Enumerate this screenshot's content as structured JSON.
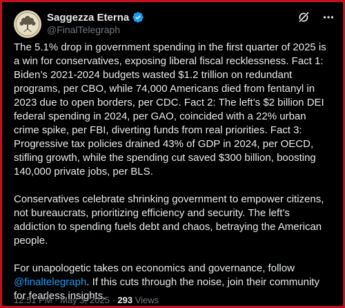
{
  "author": {
    "display_name": "Saggezza Eterna",
    "handle": "@FinalTelegraph",
    "verified": true,
    "avatar_icon": "tree-logo-icon"
  },
  "header_icons": [
    "grok-icon",
    "more-options-icon"
  ],
  "post": {
    "paragraph_1": "The 5.1% drop in government spending in the first quarter of 2025 is a win for conservatives, exposing liberal fiscal recklessness. Fact 1: Biden’s 2021-2024 budgets wasted $1.2 trillion on redundant programs, per CBO, while 74,000 Americans died from fentanyl in 2023 due to open borders, per CDC. Fact 2: The left’s $2 billion DEI federal spending in 2024, per GAO, coincided with a 22% urban crime spike, per FBI, diverting funds from real priorities. Fact 3: Progressive tax policies drained 43% of GDP in 2024, per OECD, stifling growth, while the spending cut saved $300 billion, boosting 140,000 private jobs, per BLS.",
    "paragraph_2": "Conservatives celebrate shrinking government to empower citizens, not bureaucrats, prioritizing efficiency and security. The left’s addiction to spending fuels debt and chaos, betraying the American people.",
    "paragraph_3_before": "For unapologetic takes on economics and governance, follow ",
    "paragraph_3_mention": "@finaltelegraph",
    "paragraph_3_after": ". If this cuts through the noise, join their community for fearless insights."
  },
  "meta": {
    "time": "12:51 PM",
    "separator": "·",
    "date": "May 3, 2025",
    "views_count": "293",
    "views_label": "Views"
  },
  "colors": {
    "background": "#000000",
    "text": "#e7e9ea",
    "secondary_text": "#71767b",
    "accent": "#1d9bf0",
    "outer_border": "#c8101c"
  }
}
